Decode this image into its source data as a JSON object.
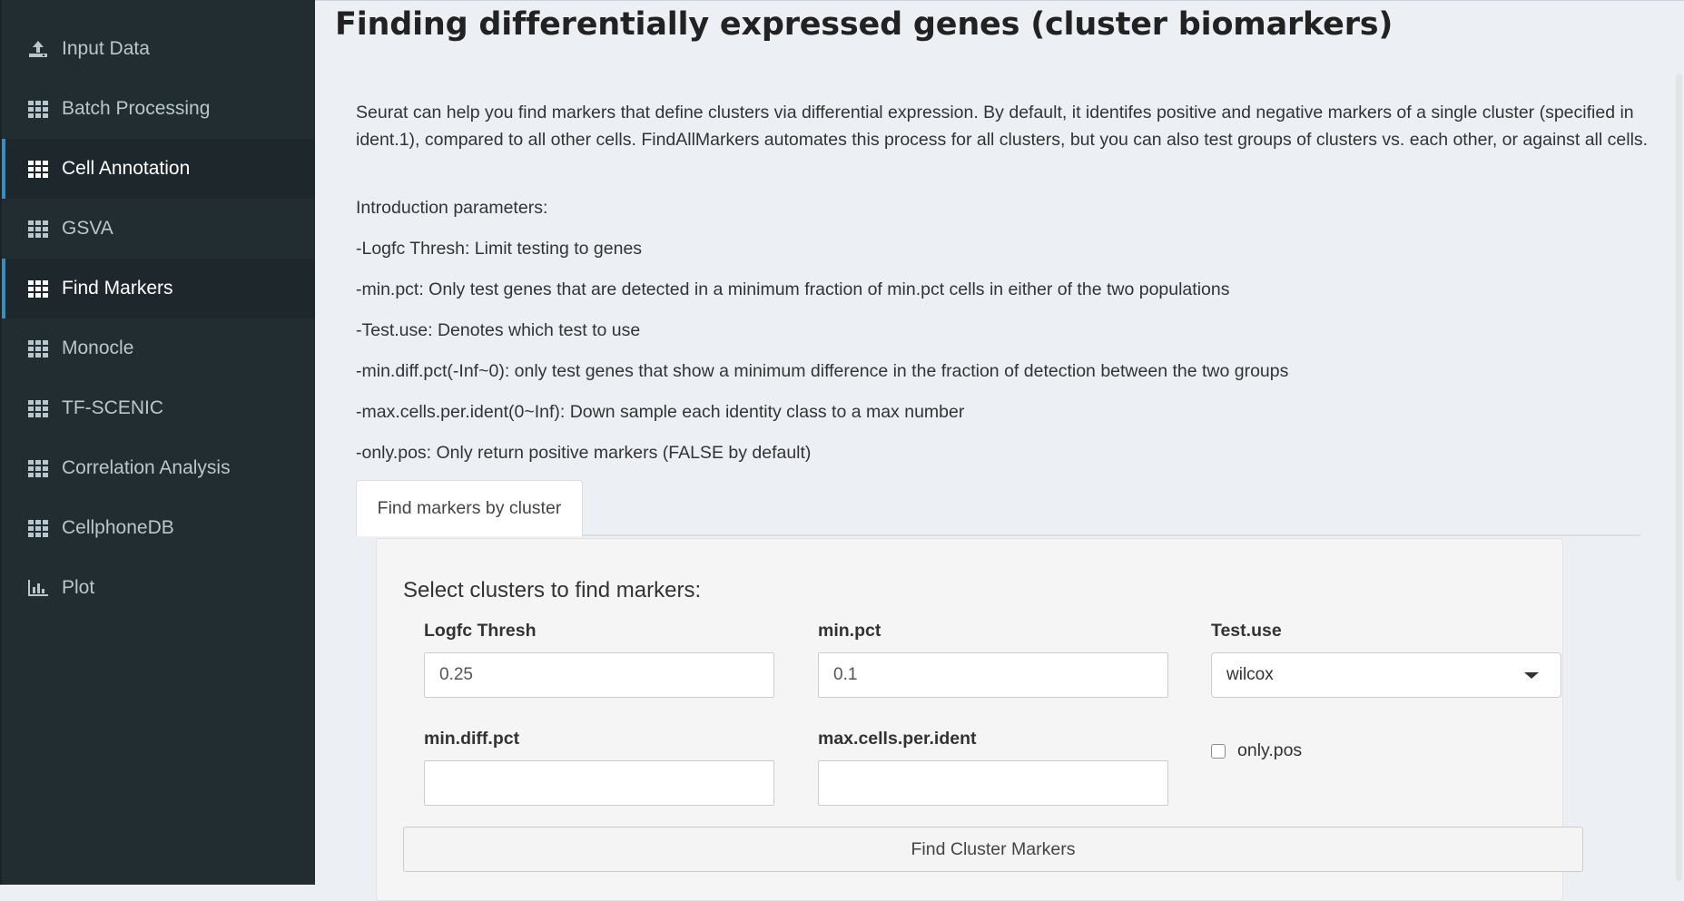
{
  "sidebar": {
    "items": [
      {
        "label": "Input Data",
        "icon": "upload-icon",
        "active": false
      },
      {
        "label": "Batch Processing",
        "icon": "grid-icon",
        "active": false
      },
      {
        "label": "Cell Annotation",
        "icon": "grid-icon",
        "active": true
      },
      {
        "label": "GSVA",
        "icon": "grid-icon",
        "active": false
      },
      {
        "label": "Find Markers",
        "icon": "grid-icon",
        "active": true
      },
      {
        "label": "Monocle",
        "icon": "grid-icon",
        "active": false
      },
      {
        "label": "TF-SCENIC",
        "icon": "grid-icon",
        "active": false
      },
      {
        "label": "Correlation Analysis",
        "icon": "grid-icon",
        "active": false
      },
      {
        "label": "CellphoneDB",
        "icon": "grid-icon",
        "active": false
      },
      {
        "label": "Plot",
        "icon": "bar-chart-icon",
        "active": false
      }
    ]
  },
  "main": {
    "title": "Finding differentially expressed genes (cluster biomarkers)",
    "paragraphs": [
      "Seurat can help you find markers that define clusters via differential expression. By default, it identifes positive and negative markers of a single cluster (specified in ident.1), compared to all other cells. FindAllMarkers automates this process for all clusters, but you can also test groups of clusters vs. each other, or against all cells.",
      "Introduction parameters:",
      "-Logfc Thresh: Limit testing to genes",
      "-min.pct: Only test genes that are detected in a minimum fraction of min.pct cells in either of the two populations",
      "-Test.use: Denotes which test to use",
      "-min.diff.pct(-Inf~0): only test genes that show a minimum difference in the fraction of detection between the two groups",
      "-max.cells.per.ident(0~Inf): Down sample each identity class to a max number",
      "-only.pos: Only return positive markers (FALSE by default)"
    ],
    "tab_label": "Find markers by cluster",
    "panel": {
      "heading": "Select clusters to find markers:",
      "logfc_label": "Logfc Thresh",
      "logfc_value": "0.25",
      "minpct_label": "min.pct",
      "minpct_value": "0.1",
      "testuse_label": "Test.use",
      "testuse_value": "wilcox",
      "mindiff_label": "min.diff.pct",
      "mindiff_value": "",
      "maxcells_label": "max.cells.per.ident",
      "maxcells_value": "",
      "onlypos_label": "only.pos",
      "onlypos_checked": false,
      "button_label": "Find Cluster Markers"
    }
  },
  "colors": {
    "sidebar_bg": "#222d32",
    "sidebar_active_bg": "#1e282c",
    "accent": "#3c8dbc",
    "content_bg": "#ecf0f5"
  }
}
